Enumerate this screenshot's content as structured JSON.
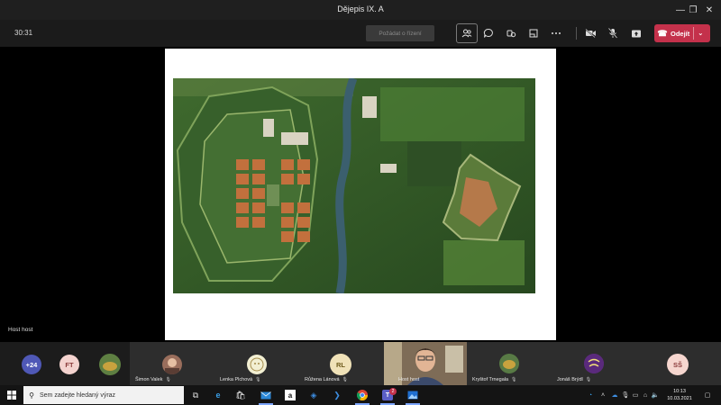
{
  "window": {
    "title": "Dějepis IX. A",
    "controls": [
      "—",
      "❐",
      "✕"
    ]
  },
  "toolbar": {
    "timer": "30:31",
    "raise_hand_label": "Požádat o řízení",
    "leave_label": "Odejít",
    "leave_color": "#c4314b",
    "icons": [
      "participants-icon",
      "chat-icon",
      "reactions-icon",
      "rooms-icon",
      "more-icon",
      "camera-off-icon",
      "mic-off-icon",
      "share-icon"
    ]
  },
  "stage": {
    "host_label": "Host host"
  },
  "participants": {
    "overflow_count": "+24",
    "tiles": [
      {
        "initials": "FT",
        "name": "",
        "color": "#f4d3cf",
        "text_color": "#8a3b3b"
      },
      {
        "initials": "",
        "name": "",
        "avatar": "photo"
      },
      {
        "initials": "",
        "name": "Šimon Valek",
        "avatar": "photo"
      },
      {
        "initials": "",
        "name": "Lenka Plchová",
        "avatar": "illustration"
      },
      {
        "initials": "RL",
        "name": "Růžena Lánová",
        "color": "#f0e2b8",
        "text_color": "#6d5a1b"
      },
      {
        "initials": "",
        "name": "Host host",
        "avatar": "video"
      },
      {
        "initials": "",
        "name": "Kryštof Trnegala",
        "avatar": "photo"
      },
      {
        "initials": "",
        "name": "Jonáš Brýdl",
        "avatar": "illustration"
      },
      {
        "initials": "SŠ",
        "name": "",
        "color": "#f6d6cf",
        "text_color": "#8a3b3b"
      }
    ]
  },
  "taskbar": {
    "search_placeholder": "Sem zadejte hledaný výraz",
    "apps": [
      "task-view-icon",
      "edge-icon",
      "store-icon",
      "mail-icon",
      "amazon-icon",
      "dropbox-icon",
      "power-automate-icon",
      "chrome-icon",
      "teams-icon",
      "photos-icon"
    ],
    "teams_badge": "2",
    "clock_time": "10:13",
    "clock_date": "10.03.2021"
  }
}
